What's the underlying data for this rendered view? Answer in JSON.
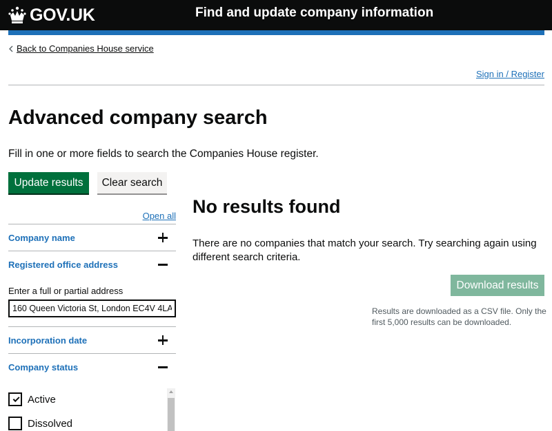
{
  "header": {
    "logo_text": "GOV.UK",
    "service_name": "Find and update company information",
    "brand_color": "#1d70b8",
    "header_bg": "#0b0c0c"
  },
  "nav": {
    "back_link": "Back to Companies House service",
    "sign_in": "Sign in / Register"
  },
  "main": {
    "title": "Advanced company search",
    "lede": "Fill in one or more fields to search the Companies House register.",
    "update_button": "Update results",
    "clear_button": "Clear search"
  },
  "filters": {
    "open_all": "Open all",
    "sections": [
      {
        "title": "Company name",
        "expanded": false,
        "icon": "plus-icon"
      },
      {
        "title": "Registered office address",
        "expanded": true,
        "icon": "minus-icon"
      },
      {
        "title": "Incorporation date",
        "expanded": false,
        "icon": "plus-icon"
      },
      {
        "title": "Company status",
        "expanded": true,
        "icon": "minus-icon"
      }
    ],
    "address": {
      "label": "Enter a full or partial address",
      "value": "160 Queen Victoria St, London EC4V 4LA,"
    },
    "status_options": [
      {
        "label": "Active",
        "checked": true
      },
      {
        "label": "Dissolved",
        "checked": false
      }
    ]
  },
  "results": {
    "heading": "No results found",
    "message": "There are no companies that match your search. Try searching again using different search criteria.",
    "download_button": "Download results",
    "download_note": "Results are downloaded as a CSV file. Only the first 5,000 results can be downloaded."
  }
}
